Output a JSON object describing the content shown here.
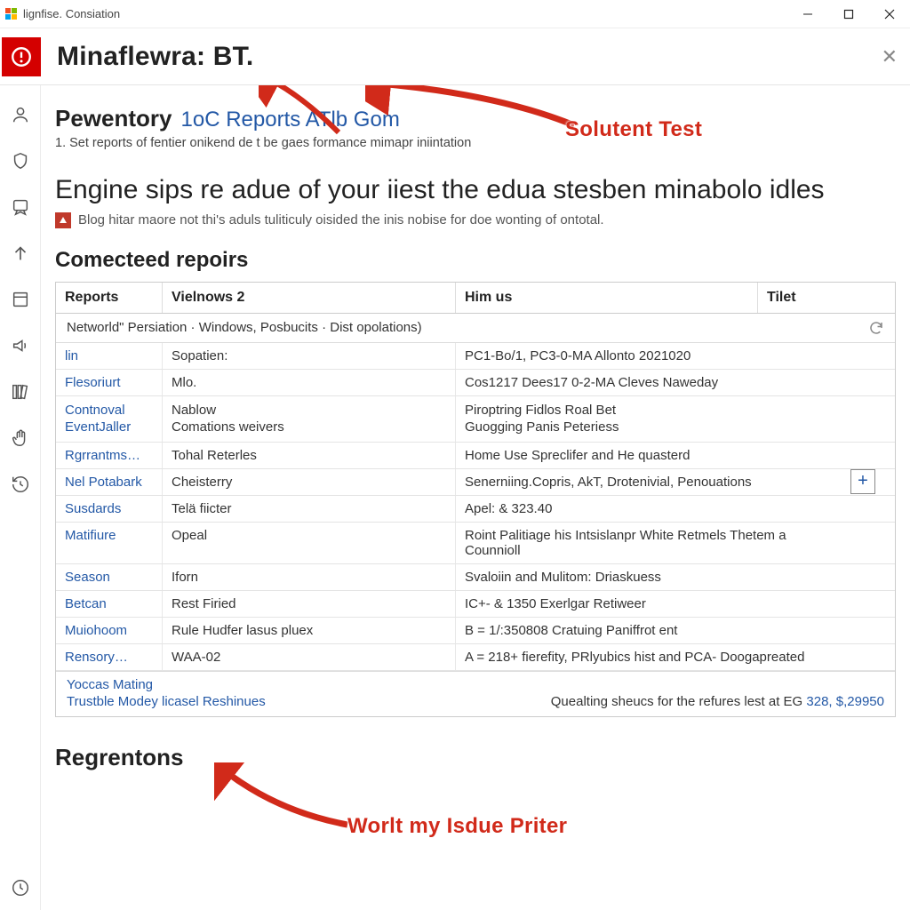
{
  "window": {
    "title": "lignfise. Consiation",
    "logo_colors": [
      "#f25022",
      "#7fba00",
      "#00a4ef",
      "#ffb900"
    ]
  },
  "header": {
    "title": "Minaflewra: BT."
  },
  "breadcrumb": {
    "strong": "Pewentory",
    "link": "1oC Reports ATlb Gom",
    "sub": "1. Set reports of fentier onikend de t be gaes formance mimapr iniintation"
  },
  "headline": "Engine sips re adue of your iiest the edua stesben minabolo idles",
  "blog_line": "Blog hitar maore not thi's aduls tuliticuly oisided the inis nobise for doe wonting of ontotal.",
  "section_title": "Comecteed repoirs",
  "table": {
    "columns": [
      "Reports",
      "Vielnows 2",
      "Him us",
      "Tilet"
    ],
    "crumb": "Networld\" Persiation · Windows, Posbucits · Dist opolations)",
    "rows": [
      {
        "c0": "lin",
        "c1": "Sopatien:",
        "c2": "PC1-Bo/1, PC3-0-MA Allonto 2021020"
      },
      {
        "c0": "Flesoriurt",
        "c1": "Mlo.",
        "c2": "Cos1217 Dees17 0-2-MA Cleves Naweday"
      },
      {
        "c0": "Contnoval EventJaller",
        "c1": "Nablow\nComations weivers",
        "c2": "Piroptring Fidlos Roal Bet\nGuogging Panis Peteriess"
      },
      {
        "c0": "Rgrrantms…",
        "c1": "Tohal Reterles",
        "c2": "Home Use Spreclifer and He quasterd"
      },
      {
        "c0": "Nel Potabark",
        "c1": "Cheisterry",
        "c2": "Senerniing.Copris, AkT, Drotenivial, Penouations"
      },
      {
        "c0": "Susdards",
        "c1": "Telä fiicter",
        "c2": "Apel: & 323.40"
      },
      {
        "c0": "Matifiure",
        "c1": "Opeal",
        "c2": "Roint Palitiage his Intsislanpr White Retmels Thetem a Counnioll"
      },
      {
        "c0": "Season",
        "c1": "Iforn",
        "c2": "Svaloiin and Mulitom: Driaskuess"
      },
      {
        "c0": "Betcan",
        "c1": "Rest Firied",
        "c2": "IC+- & 1350 Exerlgar Retiweer"
      },
      {
        "c0": "Muiohoom",
        "c1": "Rule Hudfer lasus pluex",
        "c2": "B = 1/:350808 Cratuing Paniffrot ent"
      },
      {
        "c0": "Rensory…",
        "c1": "WAA-02",
        "c2": "A = 218+ fierefity, PRlyubics hist and PCA- Doogapreated"
      }
    ],
    "footer_links": [
      "Yoccas Mating",
      "Trustble Modey licasel Reshinues"
    ],
    "summary_prefix": "Quealting sheucs for the refures lest at EG ",
    "summary_link": "328, $,29950"
  },
  "bottom_section": "Regrentons",
  "annotations": {
    "top_label": "Solutent Test",
    "bottom_label": "Worlt my Isdue Priter"
  },
  "sidebar": {
    "items": [
      "user-icon",
      "shield-icon",
      "badge-icon",
      "arrow-up-icon",
      "book-icon",
      "speaker-icon",
      "library-icon",
      "hand-icon",
      "history-icon"
    ]
  }
}
